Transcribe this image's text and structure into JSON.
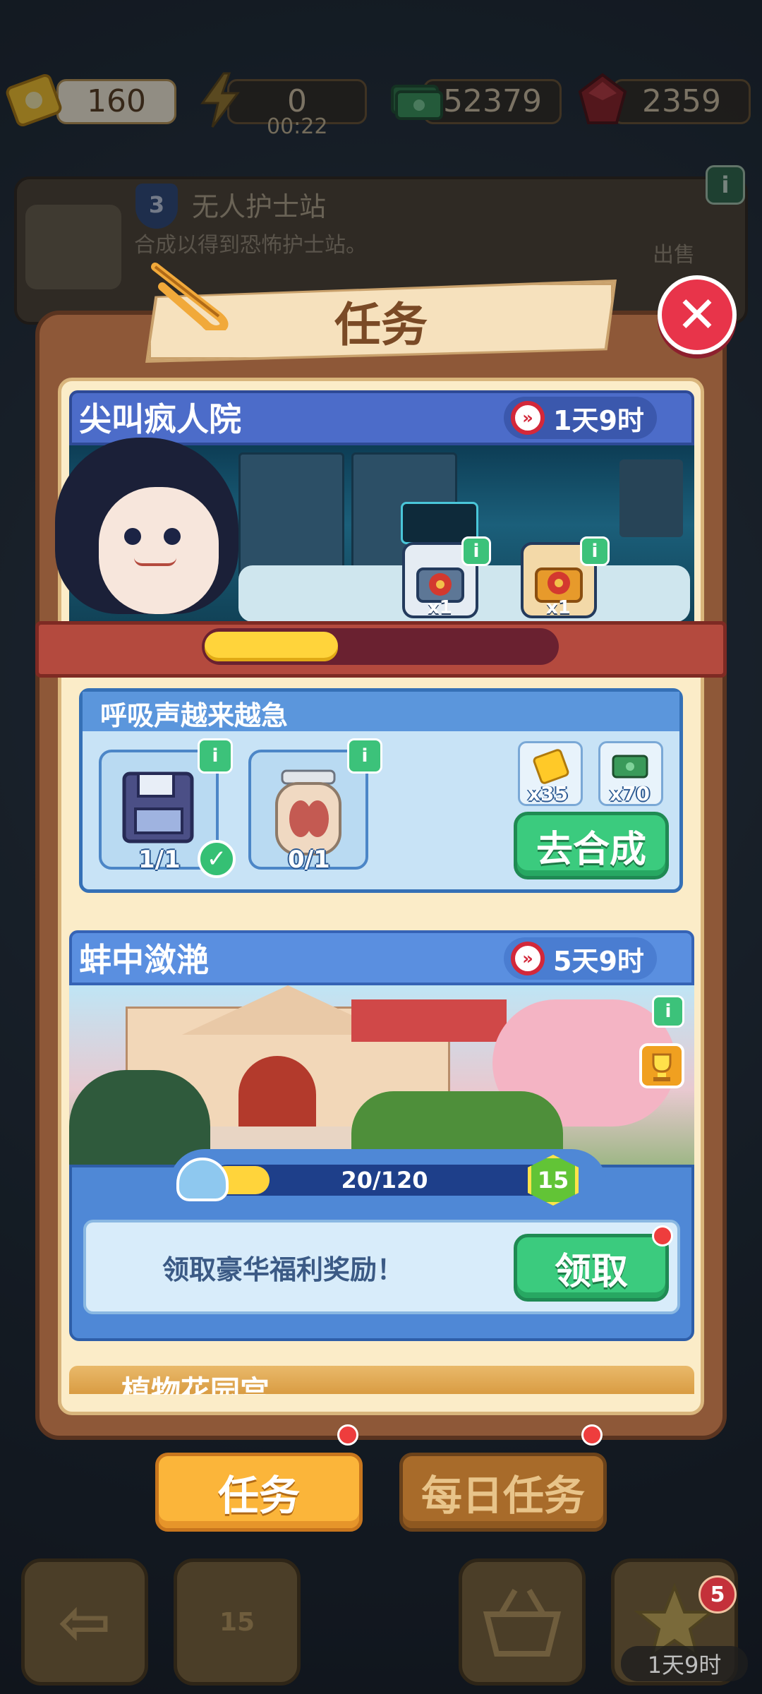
{
  "currencies": {
    "tickets": "160",
    "energy": "0",
    "energy_timer": "00:22",
    "cash": "52379",
    "gems": "2359"
  },
  "building": {
    "level": "3",
    "title": "无人护士站",
    "description": "合成以得到恐怖护士站。",
    "sell_label": "出售"
  },
  "panel": {
    "title": "任务",
    "close_glyph": "✕"
  },
  "mission1": {
    "title": "尖叫疯人院",
    "time_left": "1天9时",
    "progress_fraction": 0.38,
    "rewards": [
      {
        "name": "red-chest",
        "count": "x1"
      },
      {
        "name": "gold-chest",
        "count": "x1"
      }
    ],
    "task": {
      "title": "呼吸声越来越急",
      "items": [
        {
          "name": "floppy-disk",
          "progress": "1/1",
          "done": true
        },
        {
          "name": "lung-jar",
          "progress": "0/1",
          "done": false
        }
      ],
      "reward_tickets": "x35",
      "reward_cash": "x70",
      "action_label": "去合成"
    }
  },
  "mission2": {
    "title": "蚌中潋滟",
    "time_left": "5天9时",
    "progress_text": "20/120",
    "progress_fraction": 0.167,
    "level": "15",
    "claim_text": "领取豪华福利奖励！",
    "claim_label": "领取"
  },
  "mission3": {
    "title": "植物花园宫"
  },
  "tabs": {
    "missions": "任务",
    "daily": "每日任务"
  },
  "nav": {
    "back_glyph": "⇦",
    "trophy_level": "15",
    "star_badge": "5",
    "star_timer": "1天9时"
  },
  "colors": {
    "panel_brown": "#8e5838",
    "mission_blue": "#4c6cc9",
    "action_green": "#3bcb7e",
    "tab_orange": "#fbb53a",
    "close_red": "#e8344a"
  }
}
